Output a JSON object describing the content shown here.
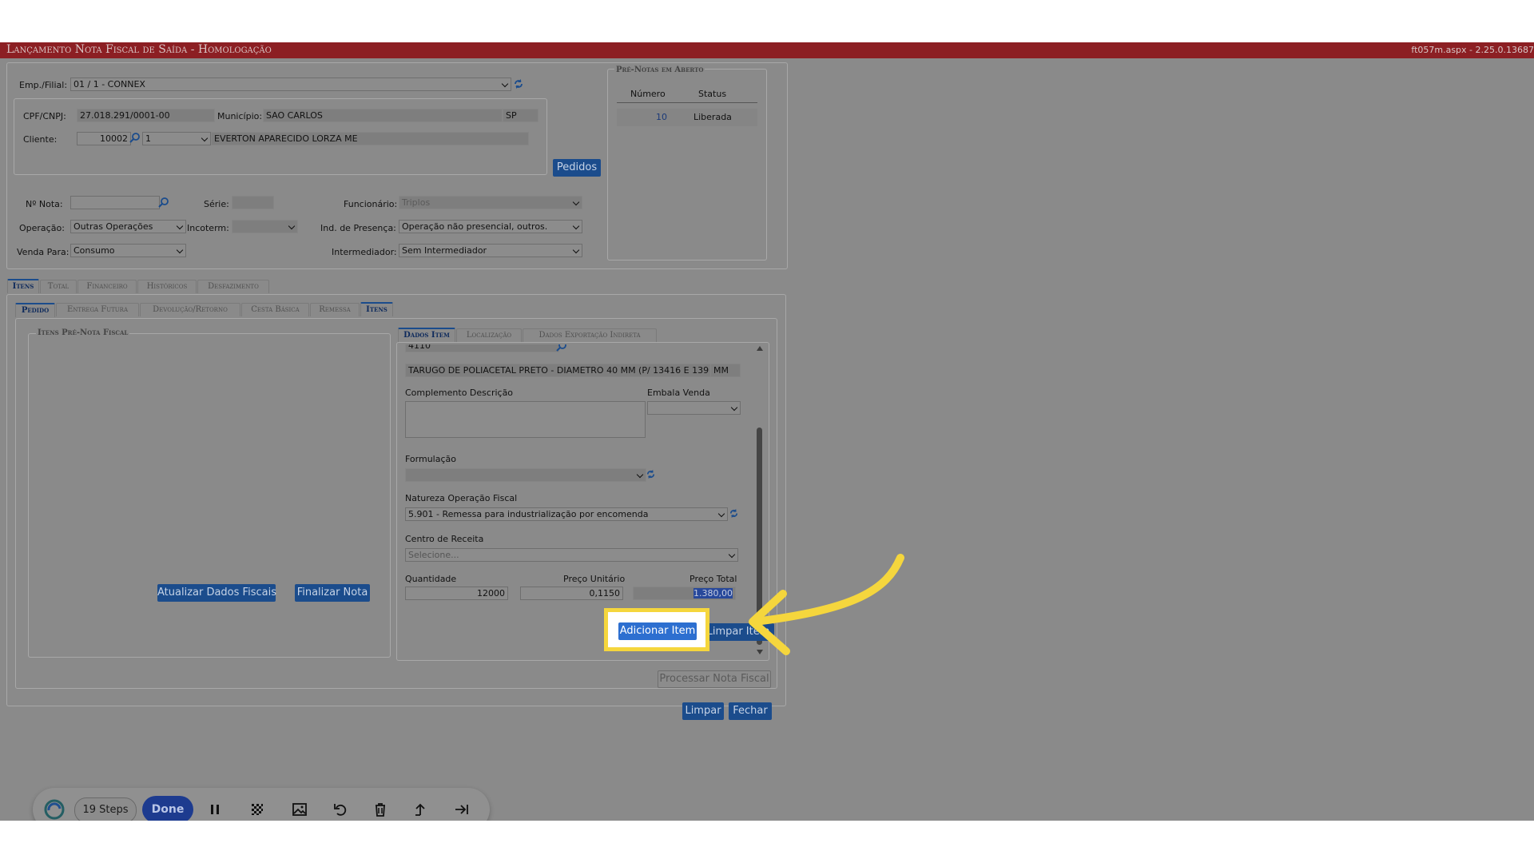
{
  "window": {
    "title": "Lançamento Nota Fiscal de Saída",
    "env": "- Homologação",
    "version": "ft057m.aspx - 2.25.0.13687"
  },
  "header": {
    "emp_label": "Emp./Filial:",
    "emp_value": "01 / 1 - CONNEX",
    "cpf_label": "CPF/CNPJ:",
    "cpf_value": "27.018.291/0001-00",
    "municipio_label": "Município:",
    "municipio_value": "SAO CARLOS",
    "uf_value": "SP",
    "cliente_label": "Cliente:",
    "cliente_code": "10002",
    "cliente_seq": "1",
    "cliente_name": "EVERTON APARECIDO LORZA ME",
    "pedidos_button": "Pedidos",
    "nota_label": "Nº Nota:",
    "nota_value": "",
    "serie_label": "Série:",
    "serie_value": "",
    "funcionario_label": "Funcionário:",
    "funcionario_value": "Triplos",
    "operacao_label": "Operação:",
    "operacao_value": "Outras Operações",
    "incoterm_label": "Incoterm:",
    "incoterm_value": "",
    "presenca_label": "Ind. de Presença:",
    "presenca_value": "Operação não presencial, outros.",
    "venda_label": "Venda Para:",
    "venda_value": "Consumo",
    "intermediador_label": "Intermediador:",
    "intermediador_value": "Sem Intermediador"
  },
  "prenotas": {
    "legend": "Pré-Notas em Aberto",
    "col_numero": "Número",
    "col_status": "Status",
    "rows": [
      {
        "numero": "10",
        "status": "Liberada"
      }
    ]
  },
  "main_tabs": [
    "Itens",
    "Total",
    "Financeiro",
    "Históricos",
    "Desfazimento"
  ],
  "sub_tabs": [
    "Pedido",
    "Entrega Futura",
    "Devolução/Retorno",
    "Cesta Básica",
    "Remessa",
    "Itens"
  ],
  "itens_prenota": {
    "legend": "Itens Pré-Nota Fiscal",
    "atualizar_button": "Atualizar Dados Fiscais",
    "finalizar_button": "Finalizar Nota"
  },
  "item_tabs": [
    "Dados Item",
    "Localização",
    "Dados Exportação Indireta"
  ],
  "item": {
    "code_partial": "4110",
    "description": "TARUGO DE POLIACETAL PRETO - DIAMETRO 40 MM (P/ 13416 E 139",
    "unit": "MM",
    "complemento_label": "Complemento Descrição",
    "embala_label": "Embala Venda",
    "embala_value": "",
    "formulacao_label": "Formulação",
    "formulacao_value": "",
    "natureza_label": "Natureza Operação Fiscal",
    "natureza_value": "5.901 - Remessa para industrialização por encomenda",
    "centro_label": "Centro de Receita",
    "centro_placeholder": "Selecione...",
    "qtd_label": "Quantidade",
    "qtd_value": "12000",
    "preco_unit_label": "Preço Unitário",
    "preco_unit_value": "0,1150",
    "preco_total_label": "Preço Total",
    "preco_total_value": "1.380,00"
  },
  "actions": {
    "adicionar": "Adicionar Item",
    "limpar_item": "Limpar Item",
    "processar": "Processar Nota Fiscal",
    "limpar": "Limpar",
    "fechar": "Fechar"
  },
  "recorder": {
    "steps": "19 Steps",
    "done": "Done"
  },
  "colors": {
    "titlebar": "#8c1f23",
    "highlight": "#f5d63d",
    "button": "#1b4c8c",
    "adicionar_button": "#2d6fd0"
  }
}
